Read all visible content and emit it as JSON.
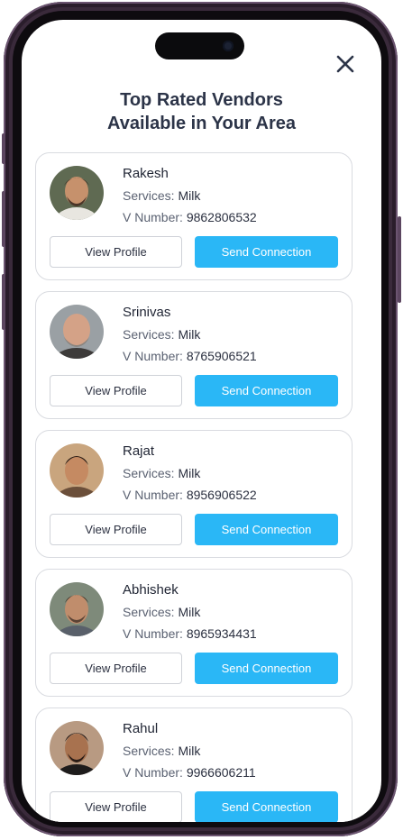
{
  "header": {
    "title_line1": "Top Rated Vendors",
    "title_line2": "Available in Your Area",
    "close_icon": "close-icon"
  },
  "labels": {
    "services_prefix": "Services: ",
    "number_prefix": "V Number: ",
    "view_profile": "View Profile",
    "send_connection": "Send Connection"
  },
  "vendors": [
    {
      "name": "Rakesh",
      "service": "Milk",
      "number": "9862806532",
      "avatar": "avatar-photo"
    },
    {
      "name": "Srinivas",
      "service": "Milk",
      "number": "8765906521",
      "avatar": "avatar-photo"
    },
    {
      "name": "Rajat",
      "service": "Milk",
      "number": "8956906522",
      "avatar": "avatar-photo"
    },
    {
      "name": "Abhishek",
      "service": "Milk",
      "number": "8965934431",
      "avatar": "avatar-photo"
    },
    {
      "name": "Rahul",
      "service": "Milk",
      "number": "9966606211",
      "avatar": "avatar-photo"
    }
  ],
  "colors": {
    "accent": "#2ab7f6",
    "title": "#2c3448",
    "frame": "#3a2a3b"
  }
}
